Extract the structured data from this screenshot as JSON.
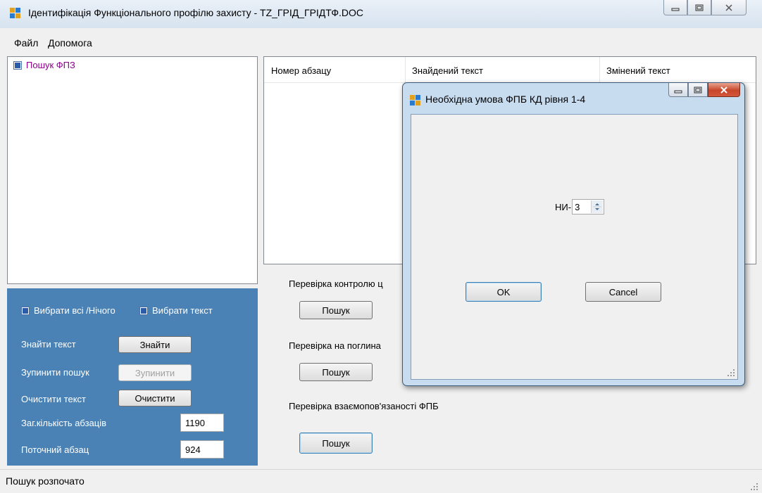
{
  "window": {
    "title": "Ідентифікація Функціонального профілю захисту - TZ_ГРІД_ГРІДТФ.DOC"
  },
  "menu": {
    "items": [
      {
        "label": "Файл"
      },
      {
        "label": "Допомога"
      }
    ]
  },
  "tree": {
    "items": [
      {
        "label": "Пошук ФПЗ",
        "checked": true
      }
    ]
  },
  "controls": {
    "select_all_label": "Вибрати всі /Нічого",
    "select_text_label": "Вибрати  текст",
    "find_text_label": "Знайти текст",
    "find_button": "Знайти",
    "stop_search_label": "Зупинити пошук",
    "stop_button": "Зупинити",
    "clear_text_label": "Очистити текст",
    "clear_button": "Очистити",
    "total_paragraphs_label": "Заг.кількість абзаців",
    "total_paragraphs_value": "1190",
    "current_paragraph_label": "Поточний абзац",
    "current_paragraph_value": "924"
  },
  "list": {
    "columns": [
      "Номер абзацу",
      "Знайдений текст",
      "Змінений текст"
    ]
  },
  "checks": {
    "check1_label": "Перевірка контролю ц",
    "check2_label": "Перевірка на поглина",
    "check3_label": "Перевірка взаємопов'язаності ФПБ",
    "search_button": "Пошук"
  },
  "status": {
    "text": "Пошук розпочато"
  },
  "dialog": {
    "title": "Необхідна умова ФПБ КД рівня 1-4",
    "spin_label": "НИ-",
    "spin_value": "3",
    "ok_button": "OK",
    "cancel_button": "Cancel"
  },
  "colors": {
    "panel_blue": "#4a82b6",
    "tree_text": "#8b008b",
    "close_button_red": "#c8462a"
  }
}
